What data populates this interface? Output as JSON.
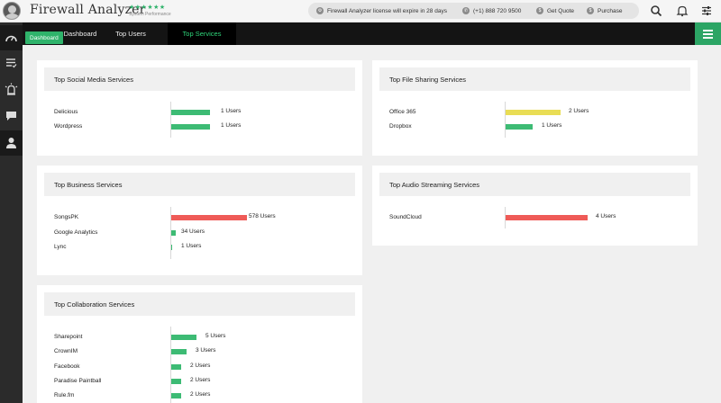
{
  "header": {
    "app_title": "Firewall Analyzer",
    "rating_stars": "★★★★★★",
    "rating_caption": "System Performance",
    "license_notice": "Firewall Analyzer license will expire in 28 days",
    "phone": "(+1) 888 720 9500",
    "get_quote": "Get Quote",
    "purchase": "Purchase",
    "icons": [
      "search-icon",
      "bell-icon",
      "settings-sliders-icon"
    ]
  },
  "tabs": [
    {
      "label": "Dashboard"
    },
    {
      "label": "Top Users"
    },
    {
      "label": "Top Services",
      "active": true
    }
  ],
  "sidebar": {
    "items": [
      "dashboard-icon",
      "reports-icon",
      "alarms-icon",
      "chat-icon",
      "user-icon"
    ],
    "tooltip": "Dashboard"
  },
  "colors": {
    "accent": "#2fb36b",
    "bar_green": "#3dbb74",
    "bar_yellow": "#e9dd55",
    "bar_red": "#ef5b57"
  },
  "cards": {
    "social": {
      "title": "Top Social Media Services",
      "rows": [
        {
          "name": "Delicious",
          "value": "1 Users",
          "users": 1,
          "color": "green"
        },
        {
          "name": "Wordpress",
          "value": "1 Users",
          "users": 1,
          "color": "green"
        }
      ]
    },
    "file_sharing": {
      "title": "Top File Sharing Services",
      "rows": [
        {
          "name": "Office 365",
          "value": "2 Users",
          "users": 2,
          "color": "yellow"
        },
        {
          "name": "Dropbox",
          "value": "1 Users",
          "users": 1,
          "color": "green"
        }
      ]
    },
    "business": {
      "title": "Top Business Services",
      "rows": [
        {
          "name": "SongsPK",
          "value": "578 Users",
          "users": 578,
          "color": "red"
        },
        {
          "name": "Google Analytics",
          "value": "34 Users",
          "users": 34,
          "color": "green"
        },
        {
          "name": "Lync",
          "value": "1 Users",
          "users": 1,
          "color": "green"
        }
      ]
    },
    "audio": {
      "title": "Top Audio Streaming Services",
      "rows": [
        {
          "name": "SoundCloud",
          "value": "4 Users",
          "users": 4,
          "color": "red"
        }
      ]
    },
    "collab": {
      "title": "Top Collaboration Services",
      "rows": [
        {
          "name": "Sharepoint",
          "value": "5 Users",
          "users": 5,
          "color": "green"
        },
        {
          "name": "CrownIM",
          "value": "3 Users",
          "users": 3,
          "color": "green"
        },
        {
          "name": "Facebook",
          "value": "2 Users",
          "users": 2,
          "color": "green"
        },
        {
          "name": "Paradise Paintball",
          "value": "2 Users",
          "users": 2,
          "color": "green"
        },
        {
          "name": "Rule.fm",
          "value": "2 Users",
          "users": 2,
          "color": "green"
        }
      ]
    }
  }
}
